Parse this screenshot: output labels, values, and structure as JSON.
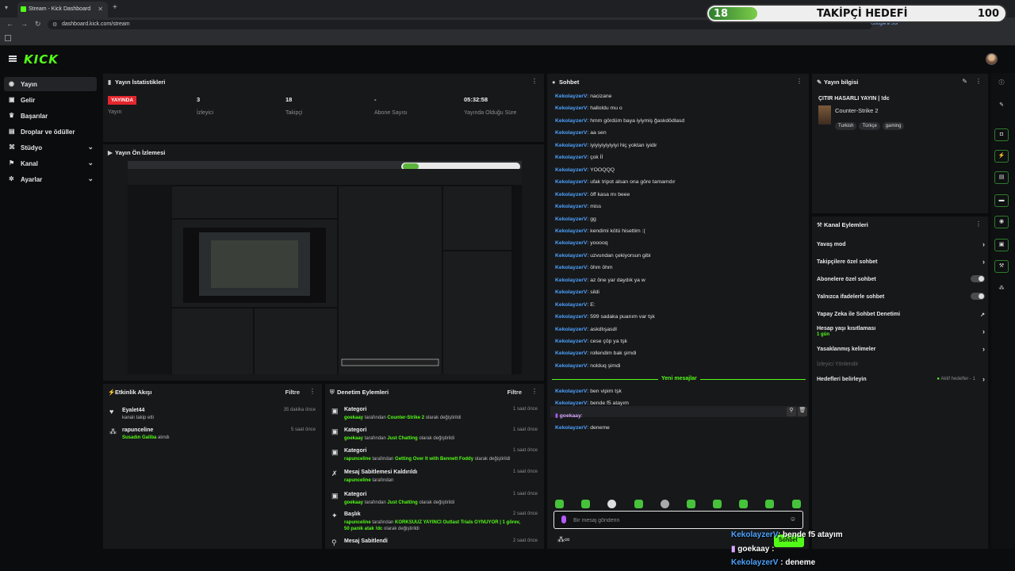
{
  "browser": {
    "tab_title": "Stream - Kick Dashboard",
    "url": "dashboard.kick.com/stream",
    "new_tab": "+",
    "search_chip": "Google'a Sor"
  },
  "goal_overlay": {
    "current": "18",
    "title": "TAKİPÇİ HEDEFİ",
    "target": "100",
    "progress_fraction": 0.18
  },
  "brand": {
    "logo": "KICK",
    "accent": "#53fc18"
  },
  "sidebar": {
    "items": [
      {
        "label": "Yayın",
        "icon": "broadcast-icon",
        "active": true
      },
      {
        "label": "Gelir",
        "icon": "money-icon"
      },
      {
        "label": "Başarılar",
        "icon": "trophy-icon"
      },
      {
        "label": "Droplar ve ödüller",
        "icon": "gift-icon"
      },
      {
        "label": "Stüdyo",
        "icon": "studio-icon",
        "expandable": true
      },
      {
        "label": "Kanal",
        "icon": "channel-icon",
        "expandable": true
      },
      {
        "label": "Ayarlar",
        "icon": "gear-icon",
        "expandable": true
      }
    ]
  },
  "stats": {
    "title": "Yayın İstatistikleri",
    "items": [
      {
        "value": "YAYINDA",
        "label": "Yayın"
      },
      {
        "value": "3",
        "label": "İzleyici"
      },
      {
        "value": "18",
        "label": "Takipçi"
      },
      {
        "value": "-",
        "label": "Abone Sayısı"
      },
      {
        "value": "05:32:58",
        "label": "Yayında Olduğu Süre"
      }
    ]
  },
  "preview": {
    "title": "Yayın Ön İzlemesi"
  },
  "chat": {
    "title": "Sohbet",
    "messages": [
      {
        "user": "KekolayzerV",
        "text": ": nacizane"
      },
      {
        "user": "KekolayzerV",
        "text": ": halloldu mu o"
      },
      {
        "user": "KekolayzerV",
        "text": ": hmm gördüm baya iyiymiş ğaskdödlasd"
      },
      {
        "user": "KekolayzerV",
        "text": ": aa sen"
      },
      {
        "user": "KekolayzerV",
        "text": ": iyiyiyiyiyiyiyi hiç yoktan iyidir"
      },
      {
        "user": "KekolayzerV",
        "text": ": çok İİ"
      },
      {
        "user": "KekolayzerV",
        "text": ": YOOQQQ"
      },
      {
        "user": "KekolayzerV",
        "text": ": ufak tripot alsan ona göre tamamdır"
      },
      {
        "user": "KekolayzerV",
        "text": ": öff kasa mı beee"
      },
      {
        "user": "KekolayzerV",
        "text": ": miss"
      },
      {
        "user": "KekolayzerV",
        "text": ": gg"
      },
      {
        "user": "KekolayzerV",
        "text": ": kendimi kötü hisettim :("
      },
      {
        "user": "KekolayzerV",
        "text": ": yooooq"
      },
      {
        "user": "KekolayzerV",
        "text": ": uzvundan çekiyorsun gibi"
      },
      {
        "user": "KekolayzerV",
        "text": ": öhm öhm"
      },
      {
        "user": "KekolayzerV",
        "text": ": az öne yar daydık ya w"
      },
      {
        "user": "KekolayzerV",
        "text": ": sildi"
      },
      {
        "user": "KekolayzerV",
        "text": ": E:"
      },
      {
        "user": "KekolayzerV",
        "text": ": 599 sadaka puanım var tşk"
      },
      {
        "user": "KekolayzerV",
        "text": ": askdlışasdl"
      },
      {
        "user": "KekolayzerV",
        "text": ": cese çöp ya tşk"
      },
      {
        "user": "KekolayzerV",
        "text": ": rollendim bak şimdi"
      },
      {
        "user": "KekolayzerV",
        "text": ": nolduq şimdi"
      }
    ],
    "new_label": "Yeni mesajlar",
    "new_messages": [
      {
        "user": "KekolayzerV",
        "text": ": ben vipim tşk"
      },
      {
        "user": "KekolayzerV",
        "text": ": bende f5 atayım"
      },
      {
        "user": "goekaay",
        "text": ":"
      },
      {
        "user": "KekolayzerV",
        "text": ": deneme"
      }
    ],
    "input_placeholder": "Bir mesaj gönderin",
    "send_label": "Sohbet",
    "points": "∞"
  },
  "stream_info": {
    "title": "Yayın bilgisi",
    "stream_title": "ÇITIR HASARLI YAYIN | !dc",
    "category": "Counter-Strike 2",
    "tags": [
      "Turkish",
      "Türkçe",
      "gaming"
    ]
  },
  "channel_actions": {
    "title": "Kanal Eylemleri",
    "rows": [
      {
        "label": "Yavaş mod",
        "kind": "chevron"
      },
      {
        "label": "Takipçilere özel sohbet",
        "kind": "chevron"
      },
      {
        "label": "Abonelere özel sohbet",
        "kind": "toggle"
      },
      {
        "label": "Yalnızca ifadelerle sohbet",
        "kind": "toggle"
      },
      {
        "label": "Yapay Zeka ile Sohbet Denetimi",
        "kind": "external"
      },
      {
        "label": "Hesap yaşı kısıtlaması",
        "sub": "1 gün",
        "kind": "chevron"
      },
      {
        "label": "Yasaklanmış kelimeler",
        "kind": "chevron"
      },
      {
        "label": "İzleyici Yönlendir",
        "kind": "disabled"
      },
      {
        "label": "Hedefleri belirleyin",
        "status": "Aktif hedefler - 1",
        "kind": "chevron"
      }
    ]
  },
  "activity": {
    "title": "Etkinlik Akışı",
    "filter": "Filtre",
    "items": [
      {
        "icon": "heart-icon",
        "name": "Eyalet44",
        "sub": "kanalı takip etti",
        "time": "35 dakika önce"
      },
      {
        "icon": "reward-icon",
        "name": "rapunceline",
        "sub_hl": "Susadın Galiba",
        "sub": " alındı",
        "time": "5 saat önce"
      }
    ]
  },
  "mod_actions": {
    "title": "Denetim Eylemleri",
    "filter": "Filtre",
    "items": [
      {
        "icon": "category-icon",
        "title": "Kategori",
        "user": "goekaay",
        "mid": " tarafından ",
        "target": "Counter-Strike 2",
        "end": " olarak değiştirildi",
        "time": "1 saat önce"
      },
      {
        "icon": "category-icon",
        "title": "Kategori",
        "user": "goekaay",
        "mid": " tarafından ",
        "target": "Just Chatting",
        "end": " olarak değiştirildi",
        "time": "1 saat önce"
      },
      {
        "icon": "category-icon",
        "title": "Kategori",
        "user": "rapunceline",
        "mid": " tarafından ",
        "target": "Getting Over It with Bennett Foddy",
        "end": " olarak değiştirildi",
        "time": "1 saat önce"
      },
      {
        "icon": "unpin-icon",
        "title": "Mesaj Sabitlemesi Kaldırıldı",
        "user": "rapunceline",
        "mid": " tarafından",
        "target": "",
        "end": "",
        "time": "1 saat önce"
      },
      {
        "icon": "category-icon",
        "title": "Kategori",
        "user": "goekaay",
        "mid": " tarafından ",
        "target": "Just Chatting",
        "end": " olarak değiştirildi",
        "time": "1 saat önce"
      },
      {
        "icon": "title-icon",
        "title": "Başlık",
        "user": "rapunceline",
        "mid": " tarafından ",
        "target": "KORKSUUZ YAYINCI Outlast Trials OYNUYOR | 1 görev, 50 panik atak !dc",
        "end": " olarak değiştirildi",
        "time": "2 saat önce"
      },
      {
        "icon": "pin-icon",
        "title": "Mesaj Sabitlendi",
        "user": "",
        "mid": "",
        "target": "",
        "end": "",
        "time": "2 saat önce"
      }
    ]
  },
  "overlay_chat": [
    {
      "user": "KekolayzerV",
      "text": ": bende f5 atayım"
    },
    {
      "user": "goekaay",
      "text": " :"
    },
    {
      "user": "KekolayzerV",
      "text": " : deneme"
    }
  ]
}
